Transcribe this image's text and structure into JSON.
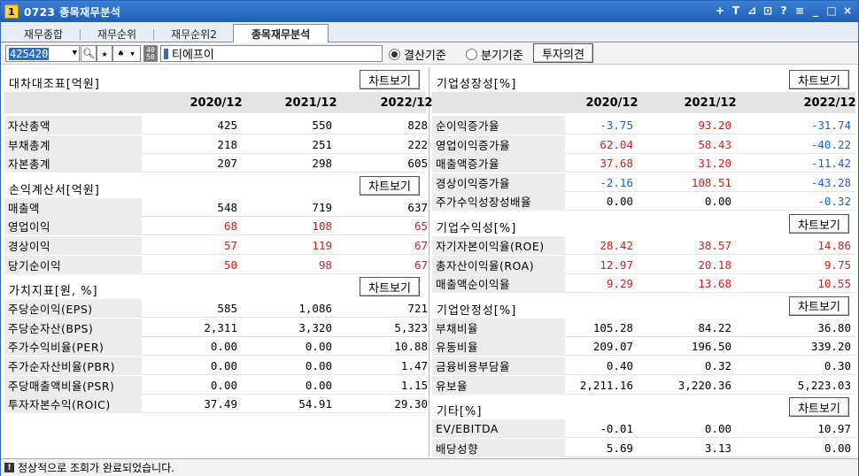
{
  "window": {
    "badge": "1",
    "title": "0723 종목재무분석",
    "controls": [
      "+",
      "T",
      "⊿",
      "⊡",
      "?",
      "≡",
      "_",
      "□",
      "×"
    ]
  },
  "tabs": [
    "재무종합",
    "재무순위",
    "재무순위2",
    "종목재무분석"
  ],
  "toolbar": {
    "code": "425420",
    "stock_name": "티에프이",
    "radio_settle": "결산기준",
    "radio_quarter": "분기기준",
    "opinion_btn": "투자의견",
    "chart_btn": "차트보기"
  },
  "periods": [
    "2020/12",
    "2021/12",
    "2022/12"
  ],
  "left": {
    "balance": {
      "title": "대차대조표[억원]",
      "rows": [
        {
          "label": "자산총액",
          "values": [
            "425",
            "550",
            "828"
          ]
        },
        {
          "label": "부채총계",
          "values": [
            "218",
            "251",
            "222"
          ]
        },
        {
          "label": "자본총계",
          "values": [
            "207",
            "298",
            "605"
          ]
        }
      ]
    },
    "income": {
      "title": "손익계산서[억원]",
      "rows": [
        {
          "label": "매출액",
          "values": [
            "548",
            "719",
            "637"
          ]
        },
        {
          "label": "영업이익",
          "values": [
            "68",
            "108",
            "65"
          ]
        },
        {
          "label": "경상이익",
          "values": [
            "57",
            "119",
            "67"
          ]
        },
        {
          "label": "당기순이익",
          "values": [
            "50",
            "98",
            "67"
          ]
        }
      ]
    },
    "value": {
      "title": "가치지표[원, %]",
      "rows": [
        {
          "label": "주당순이익(EPS)",
          "values": [
            "585",
            "1,086",
            "721"
          ]
        },
        {
          "label": "주당순자산(BPS)",
          "values": [
            "2,311",
            "3,320",
            "5,323"
          ]
        },
        {
          "label": "주가수익비율(PER)",
          "values": [
            "0.00",
            "0.00",
            "10.88"
          ]
        },
        {
          "label": "주가순자산비율(PBR)",
          "values": [
            "0.00",
            "0.00",
            "1.47"
          ]
        },
        {
          "label": "주당매출액비율(PSR)",
          "values": [
            "0.00",
            "0.00",
            "1.15"
          ]
        },
        {
          "label": "투자자본수익(ROIC)",
          "values": [
            "37.49",
            "54.91",
            "29.30"
          ]
        }
      ]
    }
  },
  "right": {
    "growth": {
      "title": "기업성장성[%]",
      "rows": [
        {
          "label": "순이익증가율",
          "values": [
            "-3.75",
            "93.20",
            "-31.74"
          ]
        },
        {
          "label": "영업이익증가율",
          "values": [
            "62.04",
            "58.43",
            "-40.22"
          ]
        },
        {
          "label": "매출액증가율",
          "values": [
            "37.68",
            "31.20",
            "-11.42"
          ]
        },
        {
          "label": "경상이익증가율",
          "values": [
            "-2.16",
            "108.51",
            "-43.28"
          ]
        },
        {
          "label": "주가수익성장성배율",
          "values": [
            "0.00",
            "0.00",
            "-0.32"
          ]
        }
      ]
    },
    "profit": {
      "title": "기업수익성[%]",
      "rows": [
        {
          "label": "자기자본이익율(ROE)",
          "values": [
            "28.42",
            "38.57",
            "14.86"
          ]
        },
        {
          "label": "총자산이익율(ROA)",
          "values": [
            "12.97",
            "20.18",
            "9.75"
          ]
        },
        {
          "label": "매출액순이익율",
          "values": [
            "9.29",
            "13.68",
            "10.55"
          ]
        }
      ]
    },
    "stability": {
      "title": "기업안정성[%]",
      "rows": [
        {
          "label": "부채비율",
          "values": [
            "105.28",
            "84.22",
            "36.80"
          ]
        },
        {
          "label": "유동비율",
          "values": [
            "209.07",
            "196.50",
            "339.20"
          ]
        },
        {
          "label": "금융비용부담율",
          "values": [
            "0.40",
            "0.32",
            "0.30"
          ]
        },
        {
          "label": "유보율",
          "values": [
            "2,211.16",
            "3,220.36",
            "5,223.03"
          ]
        }
      ]
    },
    "etc": {
      "title": "기타[%]",
      "rows": [
        {
          "label": "EV/EBITDA",
          "values": [
            "-0.01",
            "0.00",
            "10.97"
          ]
        },
        {
          "label": "배당성향",
          "values": [
            "5.69",
            "3.13",
            "0.00"
          ]
        }
      ]
    }
  },
  "colors": {
    "positive": "#d21d1d",
    "negative": "#1f5fc8",
    "titlebar": "#1f5fb4"
  },
  "status": "정상적으로 조회가 완료되었습니다."
}
